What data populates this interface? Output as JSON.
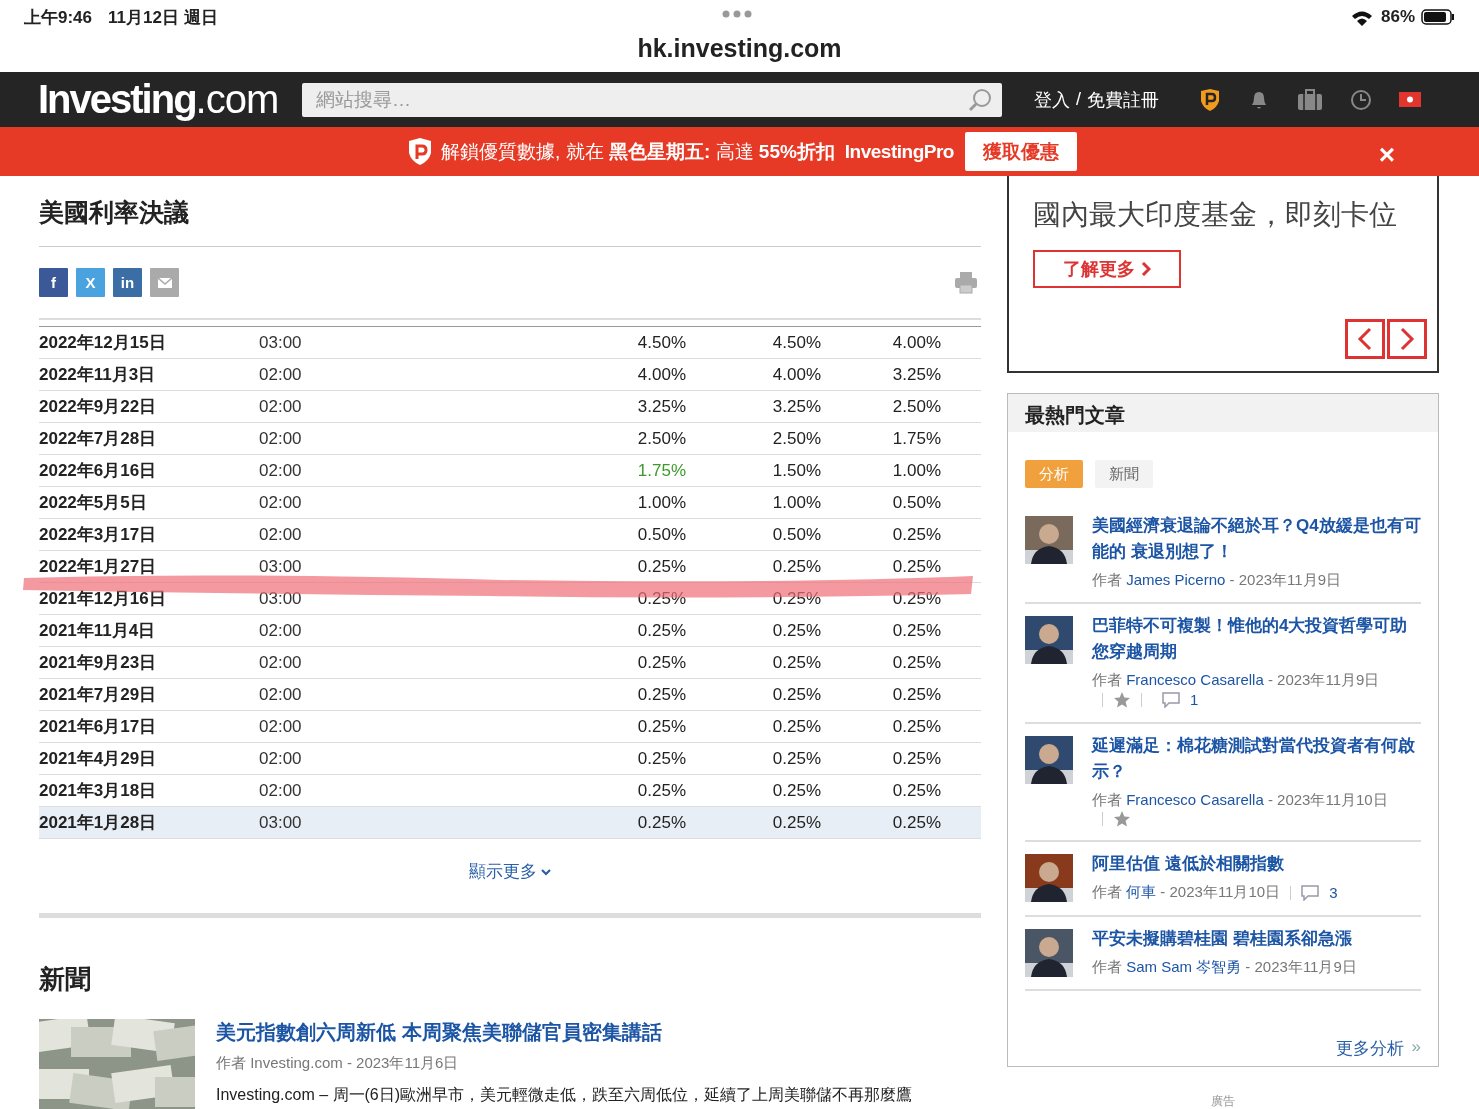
{
  "status_bar": {
    "time": "上午9:46",
    "date": "11月12日 週日",
    "battery": "86%"
  },
  "url_bar": {
    "address": "hk.investing.com"
  },
  "top_nav": {
    "logo": "**Investing**.com",
    "search": {
      "placeholder": "網站搜尋…"
    },
    "login": "登入",
    "separator": "/",
    "register": "免費註冊"
  },
  "promo_banner": {
    "message": "解鎖優質數據, 就在 **黑色星期五:** 高達 **55%折扣**",
    "brand": "InvestingPro",
    "button": "獲取優惠",
    "close": "×"
  },
  "main": {
    "title": "美國利率決議",
    "share_buttons": [
      {
        "kind": "facebook",
        "label": "f"
      },
      {
        "kind": "x",
        "label": "X"
      },
      {
        "kind": "linkedin",
        "label": "in"
      },
      {
        "kind": "email"
      }
    ],
    "table": {
      "rows": [
        {
          "date": "2022年12月15日",
          "time": "03:00",
          "actual": "4.50%",
          "forecast": "4.50%",
          "previous": "4.00%",
          "beat": false,
          "highlighted": false,
          "marked": false
        },
        {
          "date": "2022年11月3日",
          "time": "02:00",
          "actual": "4.00%",
          "forecast": "4.00%",
          "previous": "3.25%",
          "beat": false,
          "highlighted": false,
          "marked": false
        },
        {
          "date": "2022年9月22日",
          "time": "02:00",
          "actual": "3.25%",
          "forecast": "3.25%",
          "previous": "2.50%",
          "beat": false,
          "highlighted": false,
          "marked": false
        },
        {
          "date": "2022年7月28日",
          "time": "02:00",
          "actual": "2.50%",
          "forecast": "2.50%",
          "previous": "1.75%",
          "beat": false,
          "highlighted": false,
          "marked": false
        },
        {
          "date": "2022年6月16日",
          "time": "02:00",
          "actual": "1.75%",
          "forecast": "1.50%",
          "previous": "1.00%",
          "beat": true,
          "highlighted": false,
          "marked": false
        },
        {
          "date": "2022年5月5日",
          "time": "02:00",
          "actual": "1.00%",
          "forecast": "1.00%",
          "previous": "0.50%",
          "beat": false,
          "highlighted": false,
          "marked": false
        },
        {
          "date": "2022年3月17日",
          "time": "02:00",
          "actual": "0.50%",
          "forecast": "0.50%",
          "previous": "0.25%",
          "beat": false,
          "highlighted": false,
          "marked": false
        },
        {
          "date": "2022年1月27日",
          "time": "03:00",
          "actual": "0.25%",
          "forecast": "0.25%",
          "previous": "0.25%",
          "beat": false,
          "highlighted": false,
          "marked": false
        },
        {
          "date": "2021年12月16日",
          "time": "03:00",
          "actual": "0.25%",
          "forecast": "0.25%",
          "previous": "0.25%",
          "beat": false,
          "highlighted": false,
          "marked": true
        },
        {
          "date": "2021年11月4日",
          "time": "02:00",
          "actual": "0.25%",
          "forecast": "0.25%",
          "previous": "0.25%",
          "beat": false,
          "highlighted": false,
          "marked": false
        },
        {
          "date": "2021年9月23日",
          "time": "02:00",
          "actual": "0.25%",
          "forecast": "0.25%",
          "previous": "0.25%",
          "beat": false,
          "highlighted": false,
          "marked": false
        },
        {
          "date": "2021年7月29日",
          "time": "02:00",
          "actual": "0.25%",
          "forecast": "0.25%",
          "previous": "0.25%",
          "beat": false,
          "highlighted": false,
          "marked": false
        },
        {
          "date": "2021年6月17日",
          "time": "02:00",
          "actual": "0.25%",
          "forecast": "0.25%",
          "previous": "0.25%",
          "beat": false,
          "highlighted": false,
          "marked": false
        },
        {
          "date": "2021年4月29日",
          "time": "02:00",
          "actual": "0.25%",
          "forecast": "0.25%",
          "previous": "0.25%",
          "beat": false,
          "highlighted": false,
          "marked": false
        },
        {
          "date": "2021年3月18日",
          "time": "02:00",
          "actual": "0.25%",
          "forecast": "0.25%",
          "previous": "0.25%",
          "beat": false,
          "highlighted": false,
          "marked": false
        },
        {
          "date": "2021年1月28日",
          "time": "03:00",
          "actual": "0.25%",
          "forecast": "0.25%",
          "previous": "0.25%",
          "beat": false,
          "highlighted": true,
          "marked": false
        }
      ]
    },
    "show_more": "顯示更多",
    "news_title": "新聞",
    "news": [
      {
        "title": "美元指數創六周新低 本周聚焦美聯儲官員密集講話",
        "author_prefix": "作者",
        "author": "Investing.com",
        "date": "- 2023年11月6日",
        "snippet": "Investing.com – 周一(6日)歐洲早市，美元輕微走低，跌至六周低位，延續了上周美聯儲不再那麼鷹"
      }
    ]
  },
  "sidebar": {
    "ad": {
      "headline": "國內最大印度基金，即刻卡位",
      "button": "了解更多"
    },
    "popular": {
      "title": "最熱門文章",
      "tabs": [
        {
          "label": "分析",
          "selected": true
        },
        {
          "label": "新聞",
          "selected": false
        }
      ],
      "articles": [
        {
          "title": "美國經濟衰退論不絕於耳？Q4放緩是也有可能的 衰退別想了！",
          "author_prefix": "作者",
          "author": "James Picerno",
          "date": "- 2023年11月9日",
          "star": false
        },
        {
          "title": "巴菲特不可複製！惟他的4大投資哲學可助您穿越周期",
          "author_prefix": "作者",
          "author": "Francesco Casarella",
          "date": "- 2023年11月9日",
          "star": true,
          "comments": "1"
        },
        {
          "title": "延遲滿足：棉花糖測試對當代投資者有何啟示？",
          "author_prefix": "作者",
          "author": "Francesco Casarella",
          "date": "- 2023年11月10日",
          "star": true
        },
        {
          "title": "阿里估值 遠低於相關指數",
          "author_prefix": "作者",
          "author": "何車",
          "date": "- 2023年11月10日",
          "star": false,
          "comments": "3"
        },
        {
          "title": "平安未擬購碧桂園 碧桂園系卻急漲",
          "author_prefix": "作者",
          "author": "Sam Sam 岑智勇",
          "date": "- 2023年11月9日",
          "star": false
        }
      ],
      "more": "更多分析",
      "more_arrow": "»"
    },
    "ad_label": "廣告"
  }
}
